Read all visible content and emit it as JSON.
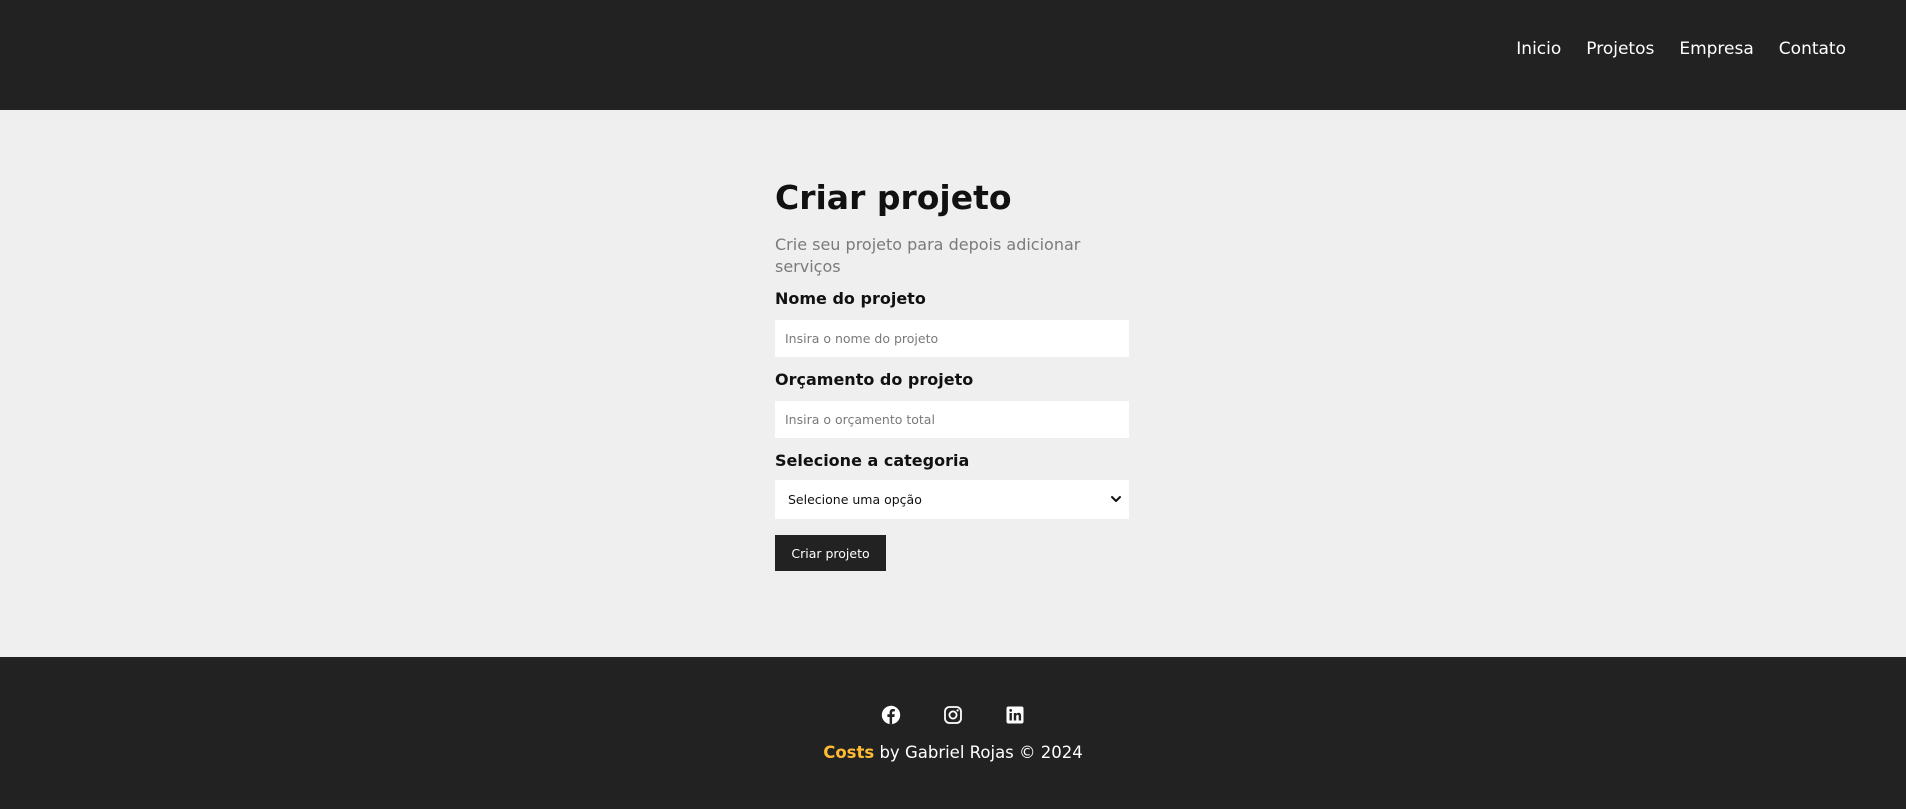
{
  "nav": {
    "items": [
      {
        "label": "Inicio"
      },
      {
        "label": "Projetos"
      },
      {
        "label": "Empresa"
      },
      {
        "label": "Contato"
      }
    ]
  },
  "form": {
    "title": "Criar projeto",
    "subtitle": "Crie seu projeto para depois adicionar serviços",
    "name_label": "Nome do projeto",
    "name_placeholder": "Insira o nome do projeto",
    "budget_label": "Orçamento do projeto",
    "budget_placeholder": "Insira o orçamento total",
    "category_label": "Selecione a categoria",
    "category_selected": "Selecione uma opção",
    "submit_label": "Criar projeto"
  },
  "footer": {
    "social_icons": [
      "facebook-icon",
      "instagram-icon",
      "linkedin-icon"
    ],
    "brand": "Costs",
    "credit": " by Gabriel Rojas © 2024"
  },
  "colors": {
    "header_bg": "#222222",
    "page_bg": "#efefef",
    "brand_accent": "#ffbb33",
    "button_bg": "#222222"
  }
}
